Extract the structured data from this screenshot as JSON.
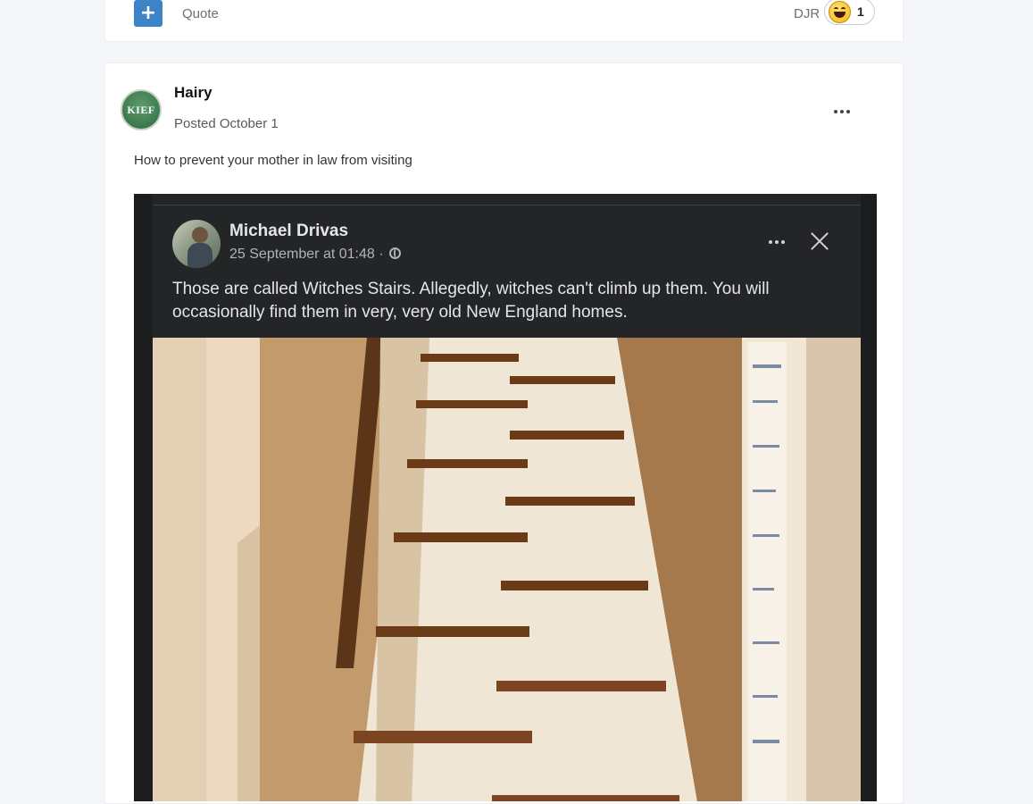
{
  "top_bar": {
    "add_icon": "plus-icon",
    "quote_label": "Quote",
    "reaction_user": "DJR",
    "reaction_emoji": "laughing-emoji-icon",
    "reaction_count": "1"
  },
  "post": {
    "avatar_text": "KIEF",
    "author": "Hairy",
    "posted": "Posted October 1",
    "more_icon": "ellipsis-icon",
    "text": "How to prevent your mother in law from visiting",
    "embed": {
      "name": "Michael Drivas",
      "date": "25 September at 01:48 ·",
      "privacy_icon": "globe-icon",
      "more_icon": "ellipsis-icon",
      "close_icon": "close-icon",
      "text": "Those are called Witches Stairs. Allegedly, witches can't climb up them. You will occasionally find them in very, very old New England homes.",
      "image": "staircase-photo"
    }
  },
  "colors": {
    "page_bg": "#f4f6f9",
    "accent": "#3c84c6",
    "fb_bg": "#242526",
    "fb_text": "#e4e6eb"
  }
}
